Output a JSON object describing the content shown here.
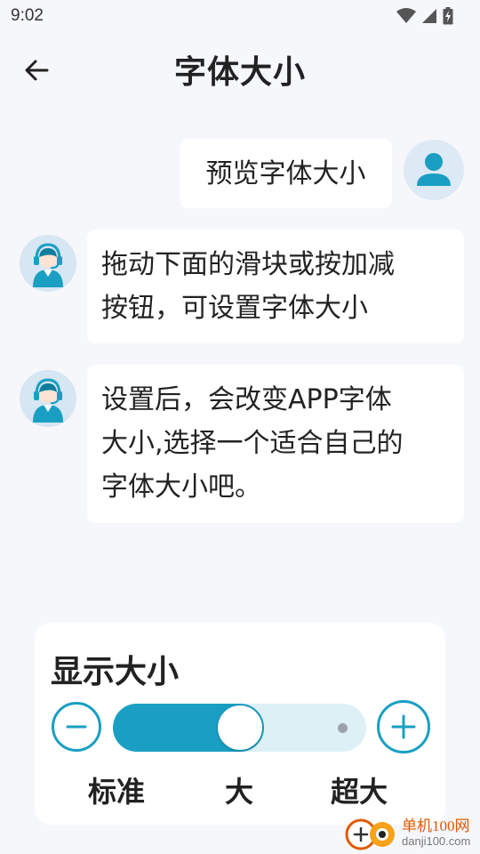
{
  "status_bar": {
    "time": "9:02"
  },
  "header": {
    "title": "字体大小"
  },
  "chat": {
    "user_message": "预览字体大小",
    "bot_messages": [
      [
        "拖动下面的滑块或按加减",
        "按钮，可设置字体大小"
      ],
      [
        "设置后，会改变APP字体",
        "大小,选择一个适合自己的",
        "字体大小吧。"
      ]
    ]
  },
  "font_panel": {
    "title": "显示大小",
    "options": [
      "标准",
      "大",
      "超大"
    ],
    "selected": "大",
    "level": 0.5
  },
  "watermark": {
    "name": "单机100网",
    "url": "danji100.com"
  },
  "colors": {
    "accent": "#1a9fc3",
    "track_light": "#dcf0f6",
    "background": "#f6f7fb",
    "watermark_orange": "#e05a00"
  },
  "icons": {
    "back": "arrow-left-icon",
    "wifi": "wifi-icon",
    "signal": "signal-icon",
    "battery": "battery-charging-icon",
    "user": "user-avatar-icon",
    "bot": "support-agent-avatar-icon",
    "minus": "minus-circle-icon",
    "plus": "plus-circle-icon"
  }
}
